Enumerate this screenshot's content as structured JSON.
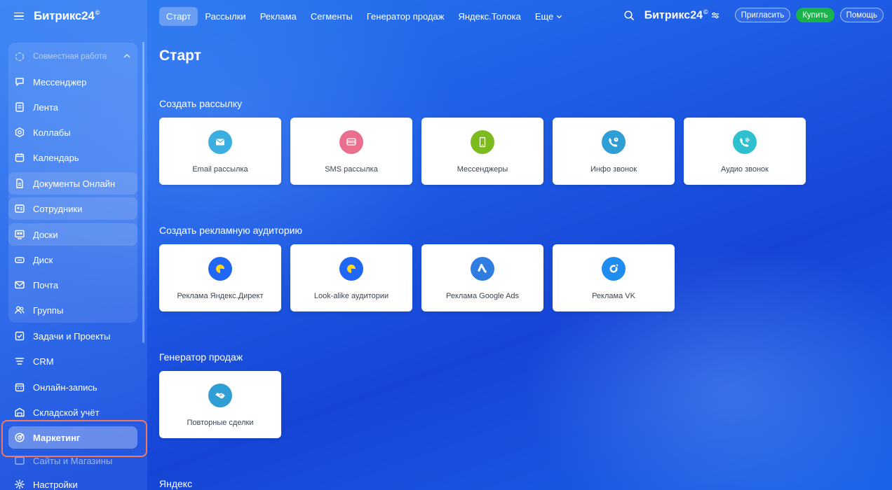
{
  "app": {
    "brand": "Битрикс24",
    "brand_mark": "©"
  },
  "sidebar": {
    "group_label": "Совместная работа",
    "items": [
      {
        "label": "Мессенджер",
        "icon": "messenger-icon"
      },
      {
        "label": "Лента",
        "icon": "feed-icon"
      },
      {
        "label": "Коллабы",
        "icon": "collabs-icon"
      },
      {
        "label": "Календарь",
        "icon": "calendar-icon"
      },
      {
        "label": "Документы Онлайн",
        "icon": "document-icon"
      },
      {
        "label": "Сотрудники",
        "icon": "employees-icon"
      },
      {
        "label": "Доски",
        "icon": "boards-icon"
      },
      {
        "label": "Диск",
        "icon": "disk-icon"
      },
      {
        "label": "Почта",
        "icon": "mail-icon"
      },
      {
        "label": "Группы",
        "icon": "groups-icon"
      },
      {
        "label": "Задачи и Проекты",
        "icon": "tasks-icon"
      },
      {
        "label": "CRM",
        "icon": "crm-icon"
      },
      {
        "label": "Онлайн-запись",
        "icon": "booking-icon"
      },
      {
        "label": "Складской учёт",
        "icon": "warehouse-icon"
      },
      {
        "label": "Маркетинг",
        "icon": "marketing-icon"
      },
      {
        "label": "Сайты и Магазины",
        "icon": "sites-icon"
      },
      {
        "label": "Настройки",
        "icon": "settings-icon"
      }
    ]
  },
  "topbar": {
    "tabs": [
      "Старт",
      "Рассылки",
      "Реклама",
      "Сегменты",
      "Генератор продаж",
      "Яндекс.Толока",
      "Еще"
    ],
    "active_tab": "Старт",
    "invite_label": "Пригласить",
    "buy_label": "Купить",
    "help_label": "Помощь"
  },
  "main": {
    "title": "Старт",
    "sections": [
      {
        "title": "Создать рассылку",
        "cards": [
          {
            "label": "Email рассылка",
            "icon": "email-icon",
            "color": "#3bb0e0"
          },
          {
            "label": "SMS рассылка",
            "icon": "sms-icon",
            "color": "#ea6f8f"
          },
          {
            "label": "Мессенджеры",
            "icon": "phone-icon",
            "color": "#7bbb1e"
          },
          {
            "label": "Инфо звонок",
            "icon": "info-call-icon",
            "color": "#2f9ed4"
          },
          {
            "label": "Аудио звонок",
            "icon": "audio-call-icon",
            "color": "#2ec0cf"
          }
        ]
      },
      {
        "title": "Создать рекламную аудиторию",
        "cards": [
          {
            "label": "Реклама Яндекс.Директ",
            "icon": "yandex-direct-icon",
            "color": "#2167f5"
          },
          {
            "label": "Look-alike аудитории",
            "icon": "yandex-direct-icon",
            "color": "#2167f5"
          },
          {
            "label": "Реклама Google Ads",
            "icon": "google-ads-icon",
            "color": "#2f7de1"
          },
          {
            "label": "Реклама VK",
            "icon": "vk-ads-icon",
            "color": "#1f8cf0"
          }
        ]
      },
      {
        "title": "Генератор продаж",
        "cards": [
          {
            "label": "Повторные сделки",
            "icon": "handshake-icon",
            "color": "#2f9ed4"
          }
        ]
      },
      {
        "title": "Яндекс",
        "cards": []
      }
    ]
  }
}
